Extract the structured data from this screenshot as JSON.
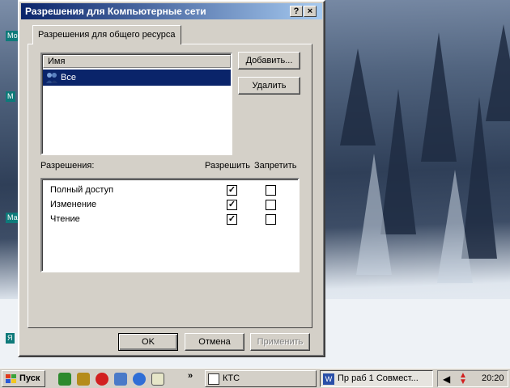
{
  "dialog": {
    "title": "Разрешения для Компьютерные сети",
    "help_button": "?",
    "close_button": "×",
    "tab_label": "Разрешения для общего ресурса",
    "names_header": "Имя",
    "names": [
      {
        "label": "Все",
        "selected": true
      }
    ],
    "add_button": "Добавить...",
    "remove_button": "Удалить",
    "permissions_label": "Разрешения:",
    "allow_header": "Разрешить",
    "deny_header": "Запретить",
    "permissions": [
      {
        "name": "Полный доступ",
        "allow": true,
        "deny": false
      },
      {
        "name": "Изменение",
        "allow": true,
        "deny": false
      },
      {
        "name": "Чтение",
        "allow": true,
        "deny": false
      }
    ],
    "ok_button": "OK",
    "cancel_button": "Отмена",
    "apply_button": "Применить"
  },
  "desktop": {
    "icon_labels": [
      "Мо",
      "М",
      "Ма",
      "Я"
    ]
  },
  "taskbar": {
    "start_label": "Пуск",
    "overflow": "»",
    "tasks": [
      {
        "label": "КТС"
      },
      {
        "label": "Пр раб 1 Совмест..."
      }
    ],
    "clock": "20:20",
    "quicklaunch_icons": [
      "winamp-icon",
      "messenger-icon",
      "opera-icon",
      "network-icon",
      "ie-icon",
      "notepad-icon"
    ]
  },
  "colors": {
    "titlebar_start": "#0a246a",
    "titlebar_end": "#a6caf0",
    "selection": "#0a246a",
    "face": "#d4d0c8"
  }
}
